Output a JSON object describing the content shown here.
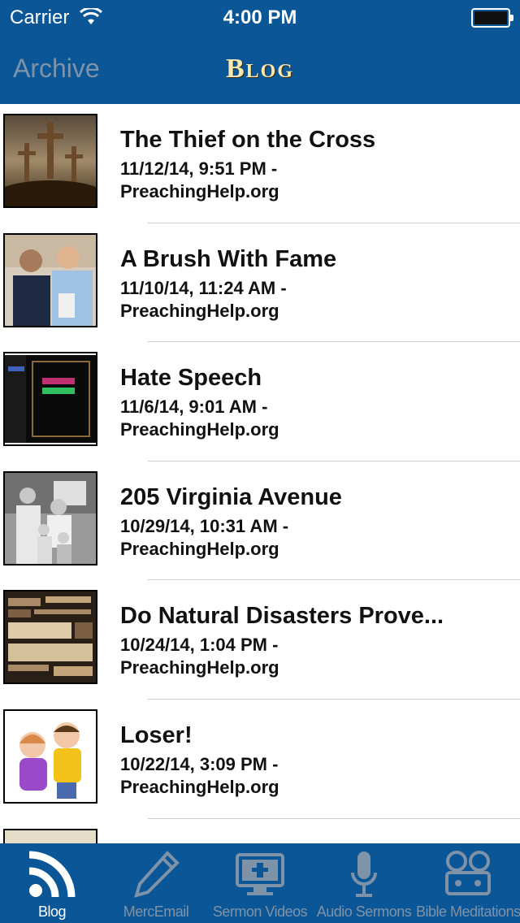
{
  "status_bar": {
    "carrier": "Carrier",
    "time": "4:00 PM"
  },
  "nav": {
    "back_label": "Archive",
    "title": "Blog"
  },
  "posts": [
    {
      "title": "The Thief on the Cross",
      "date": "11/12/14, 9:51 PM -",
      "source": "PreachingHelp.org",
      "thumb": "crosses-image"
    },
    {
      "title": "A Brush With Fame",
      "date": "11/10/14, 11:24 AM -",
      "source": "PreachingHelp.org",
      "thumb": "two-men-photo"
    },
    {
      "title": "Hate Speech",
      "date": "11/6/14, 9:01 AM -",
      "source": "PreachingHelp.org",
      "thumb": "bible-book-image"
    },
    {
      "title": "205 Virginia Avenue",
      "date": "10/29/14, 10:31 AM -",
      "source": "PreachingHelp.org",
      "thumb": "family-photo"
    },
    {
      "title": "Do Natural Disasters Prove...",
      "date": "10/24/14, 1:04 PM -",
      "source": "PreachingHelp.org",
      "thumb": "word-collage-image"
    },
    {
      "title": "Loser!",
      "date": "10/22/14, 3:09 PM -",
      "source": "PreachingHelp.org",
      "thumb": "children-photo"
    }
  ],
  "tabs": [
    {
      "label": "Blog",
      "icon": "rss-icon",
      "active": true
    },
    {
      "label": "MercEmail",
      "icon": "pencil-icon",
      "active": false
    },
    {
      "label": "Sermon Videos",
      "icon": "monitor-icon",
      "active": false
    },
    {
      "label": "Audio Sermons",
      "icon": "microphone-icon",
      "active": false
    },
    {
      "label": "Bible Meditations",
      "icon": "projector-icon",
      "active": false
    }
  ],
  "colors": {
    "bar": "#0b5697",
    "title": "#f7e7b0",
    "inactive": "#7e93a8"
  }
}
